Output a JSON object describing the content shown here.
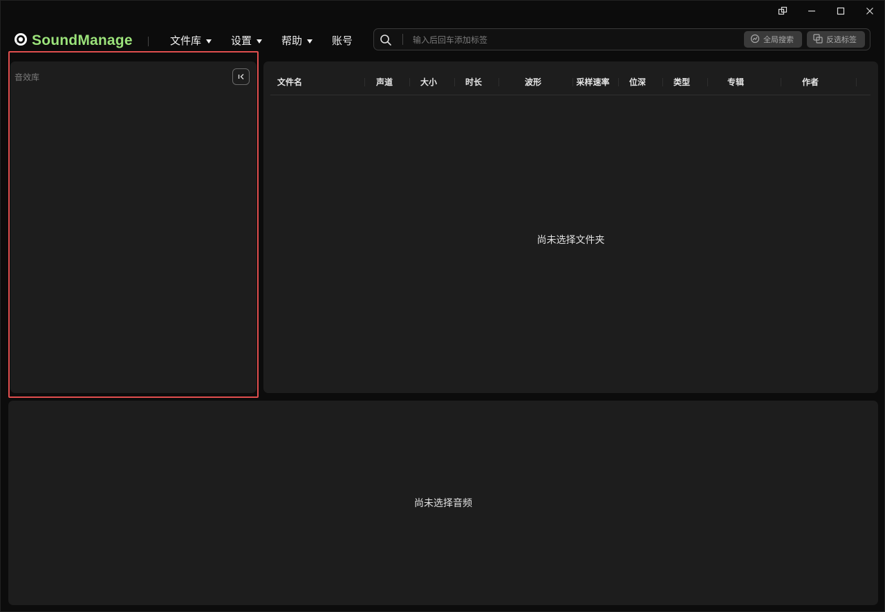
{
  "app": {
    "name": "SoundManage",
    "brand_color": "#9be27a"
  },
  "window_controls": {
    "restore_icon": "restore-icon",
    "minimize_icon": "minimize-icon",
    "maximize_icon": "maximize-icon",
    "close_icon": "close-icon"
  },
  "nav": {
    "library": "文件库",
    "settings": "设置",
    "help": "帮助",
    "account": "账号"
  },
  "search": {
    "placeholder": "输入后回车添加标签",
    "global_search": "全局搜索",
    "inverse_tags": "反选标签"
  },
  "sidebar": {
    "title": "音效库"
  },
  "file_table": {
    "columns": [
      "文件名",
      "声道",
      "大小",
      "时长",
      "波形",
      "采样速率",
      "位深",
      "类型",
      "专辑",
      "作者"
    ],
    "empty_message": "尚未选择文件夹"
  },
  "player": {
    "empty_message": "尚未选择音频"
  }
}
